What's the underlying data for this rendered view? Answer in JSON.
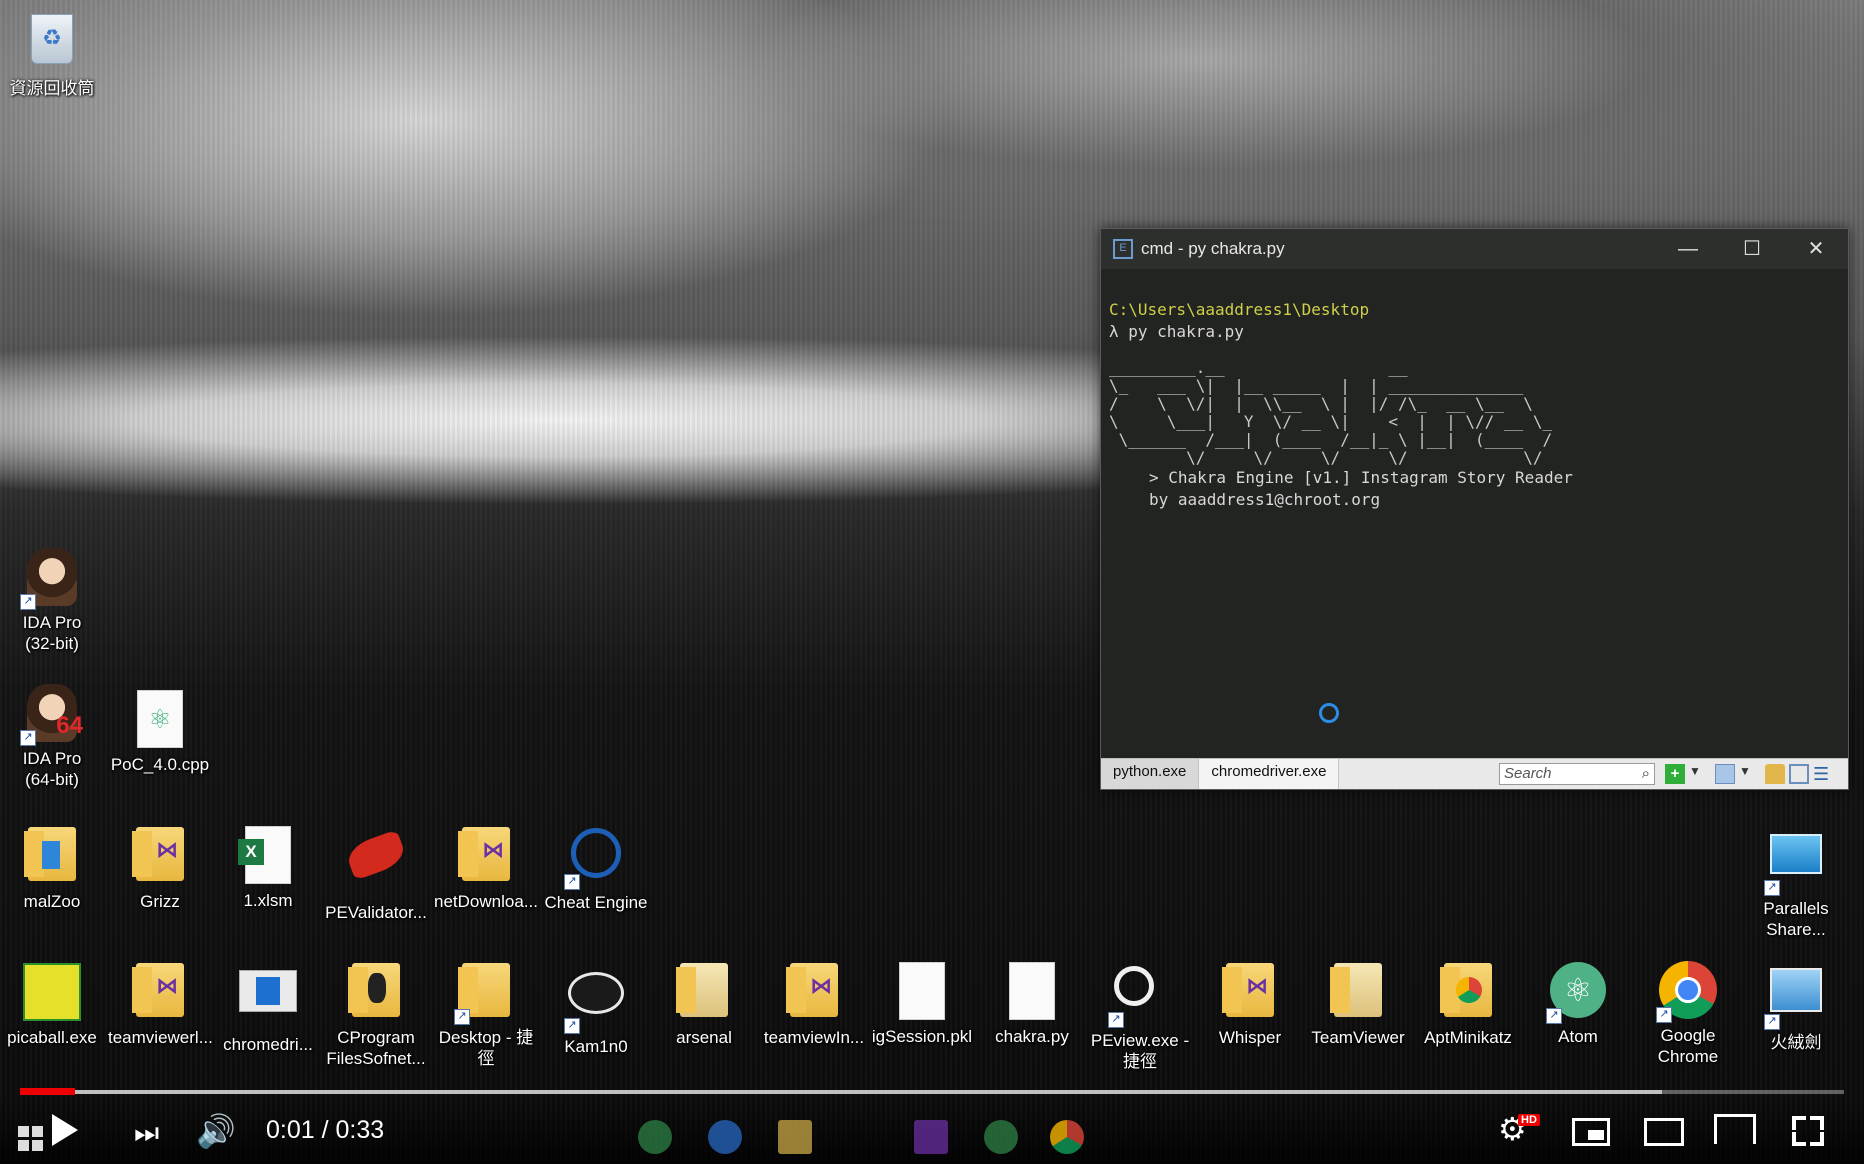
{
  "desktop": {
    "icons": [
      {
        "id": "recycle",
        "label": "資源回收筒"
      },
      {
        "id": "ida32",
        "label": "IDA Pro\n(32-bit)"
      },
      {
        "id": "ida64",
        "label": "IDA Pro\n(64-bit)"
      },
      {
        "id": "poc",
        "label": "PoC_4.0.cpp"
      },
      {
        "id": "malzoo",
        "label": "malZoo"
      },
      {
        "id": "grizz",
        "label": "Grizz"
      },
      {
        "id": "xlsm",
        "label": "1.xlsm"
      },
      {
        "id": "pevalidator",
        "label": "PEValidator..."
      },
      {
        "id": "netdownload",
        "label": "netDownloa..."
      },
      {
        "id": "cheatengine",
        "label": "Cheat Engine"
      },
      {
        "id": "parallels",
        "label": "Parallels\nShare..."
      },
      {
        "id": "picaball",
        "label": "picaball.exe"
      },
      {
        "id": "teamviewerl",
        "label": "teamviewerl..."
      },
      {
        "id": "chromedri",
        "label": "chromedri..."
      },
      {
        "id": "cprogram",
        "label": "CProgram\nFilesSofnet..."
      },
      {
        "id": "desktop",
        "label": "Desktop - 捷\n徑"
      },
      {
        "id": "kam1n0",
        "label": "Kam1n0"
      },
      {
        "id": "arsenal",
        "label": "arsenal"
      },
      {
        "id": "teamviewin",
        "label": "teamviewIn..."
      },
      {
        "id": "igsession",
        "label": "igSession.pkl"
      },
      {
        "id": "chakrapy",
        "label": "chakra.py"
      },
      {
        "id": "peview",
        "label": "PEview.exe -\n捷徑"
      },
      {
        "id": "whisper",
        "label": "Whisper"
      },
      {
        "id": "teamviewer",
        "label": "TeamViewer"
      },
      {
        "id": "aptminikatz",
        "label": "AptMinikatz"
      },
      {
        "id": "atom",
        "label": "Atom"
      },
      {
        "id": "chrome",
        "label": "Google\nChrome"
      },
      {
        "id": "huorongjian",
        "label": "火絨劍"
      }
    ]
  },
  "console": {
    "title": "cmd - py  chakra.py",
    "minimize": "—",
    "maximize": "☐",
    "close": "✕",
    "path_line": "C:\\Users\\aaaddress1\\Desktop",
    "cmd_line": "λ py chakra.py",
    "ascii_art": "_________.__                 __\n\\_   ___ \\|  |__ _____  |  | ______________\n/    \\  \\/|  |  \\\\__  \\ |  |/ /\\_  __ \\__  \\\n\\     \\___|   Y  \\/ __ \\|    <  |  | \\// __ \\_\n \\______  /___|  (____  /__|_ \\ |__|  (____  /\n        \\/     \\/     \\/     \\/            \\/",
    "banner_line1": "> Chakra Engine [v1.] Instagram Story Reader",
    "banner_line2": "by aaaddress1@chroot.org",
    "tabs": [
      "python.exe",
      "chromedriver.exe"
    ],
    "search_placeholder": "Search"
  },
  "player": {
    "current_time": "0:01",
    "separator": " / ",
    "duration": "0:33",
    "progress_played": 0.03,
    "progress_buffered": 0.9,
    "hd_badge": "HD"
  }
}
